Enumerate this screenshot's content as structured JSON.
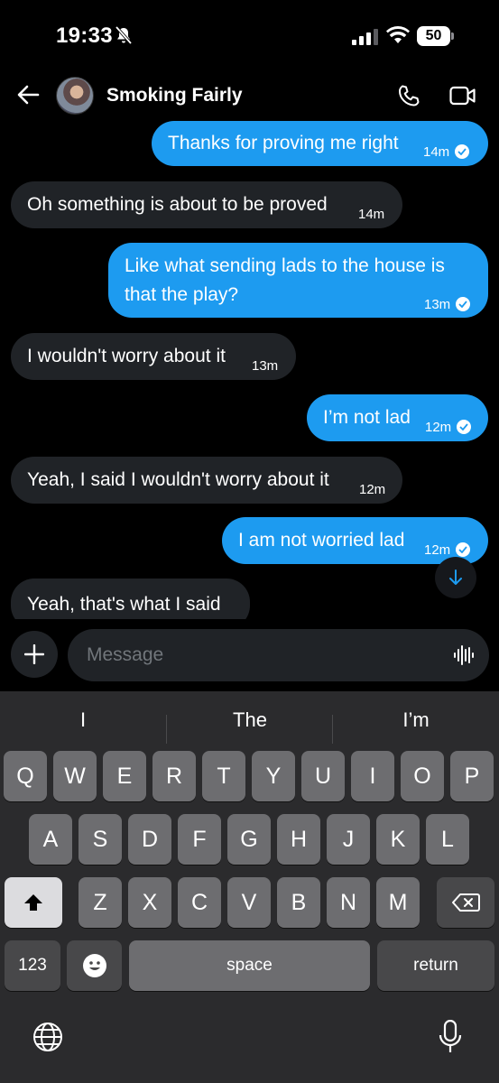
{
  "status_bar": {
    "time": "19:33",
    "battery": "50"
  },
  "header": {
    "contact_name": "Smoking Fairly"
  },
  "messages": [
    {
      "side": "sent",
      "text": "Thanks for proving me right",
      "time": "14m"
    },
    {
      "side": "received",
      "text": "Oh something is about to be proved",
      "time": "14m"
    },
    {
      "side": "sent",
      "lines": [
        "Like what sending lads to the house is",
        "that the play?"
      ],
      "time": "13m"
    },
    {
      "side": "received",
      "text": "I wouldn't worry about it",
      "time": "13m"
    },
    {
      "side": "sent",
      "text": "I’m not lad",
      "time": "12m"
    },
    {
      "side": "received",
      "text": "Yeah, I said I wouldn't worry about it",
      "time": "12m"
    },
    {
      "side": "sent",
      "text": "I am not worried lad",
      "time": "12m"
    },
    {
      "side": "received",
      "text": "Yeah, that's what I said",
      "time": ""
    }
  ],
  "composer": {
    "placeholder": "Message"
  },
  "keyboard": {
    "suggestions": [
      "I",
      "The",
      "I’m"
    ],
    "row1": [
      "Q",
      "W",
      "E",
      "R",
      "T",
      "Y",
      "U",
      "I",
      "O",
      "P"
    ],
    "row2": [
      "A",
      "S",
      "D",
      "F",
      "G",
      "H",
      "J",
      "K",
      "L"
    ],
    "row3": [
      "Z",
      "X",
      "C",
      "V",
      "B",
      "N",
      "M"
    ],
    "numbers_key": "123",
    "space_key": "space",
    "return_key": "return"
  },
  "colors": {
    "sent_bubble": "#1d9bf0",
    "received_bubble": "#202327",
    "background": "#000000"
  },
  "icons": [
    "back-arrow-icon",
    "phone-icon",
    "video-icon",
    "plus-icon",
    "voice-icon",
    "shift-icon",
    "delete-icon",
    "emoji-icon",
    "globe-icon",
    "mic-icon",
    "chevron-down-icon"
  ]
}
